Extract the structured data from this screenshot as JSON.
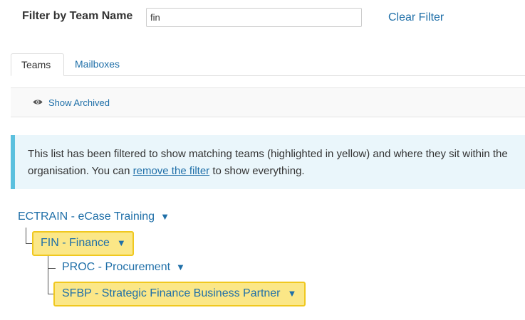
{
  "filter": {
    "label": "Filter by Team Name",
    "value": "fin",
    "clear_label": "Clear Filter"
  },
  "tabs": [
    {
      "label": "Teams",
      "active": true
    },
    {
      "label": "Mailboxes",
      "active": false
    }
  ],
  "archived": {
    "icon": "eye-icon",
    "label": "Show Archived"
  },
  "alert": {
    "text_before": "This list has been filtered to show matching teams (highlighted in yellow) and where they sit within the organisation. You can ",
    "link": "remove the filter",
    "text_after": " to show everything."
  },
  "tree": {
    "caret": "▼",
    "nodes": [
      {
        "label": "ECTRAIN - eCase Training",
        "highlighted": false
      },
      {
        "label": "FIN - Finance",
        "highlighted": true
      },
      {
        "label": "PROC - Procurement",
        "highlighted": false
      },
      {
        "label": "SFBP - Strategic Finance Business Partner",
        "highlighted": true
      }
    ]
  },
  "colors": {
    "link": "#1f6fa8",
    "highlight_bg": "#fbe787",
    "highlight_border": "#f0c81f",
    "alert_bg": "#eaf6fb",
    "alert_border": "#5bc0de"
  }
}
